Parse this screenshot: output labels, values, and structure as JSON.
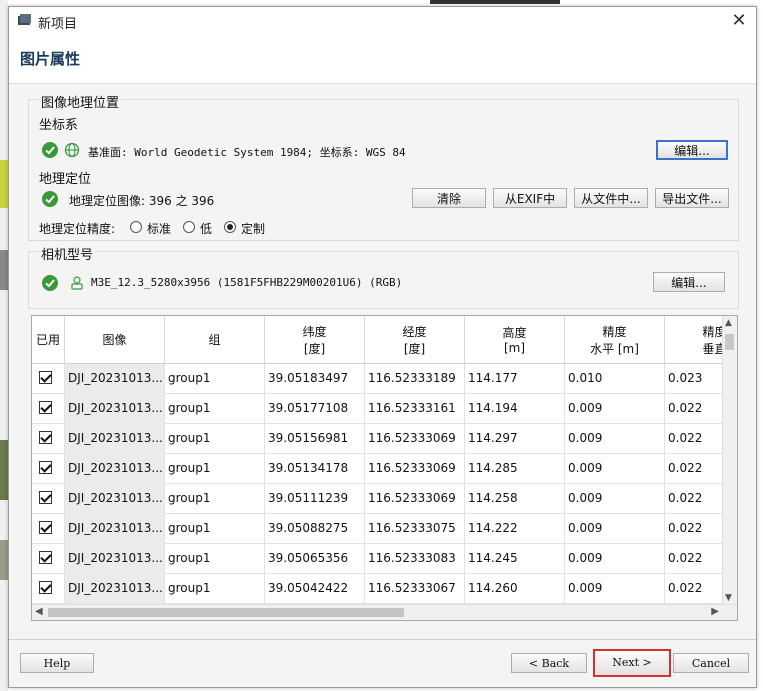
{
  "window": {
    "title": "新项目",
    "close_symbol": "✕"
  },
  "header": {
    "title": "图片属性"
  },
  "geo": {
    "group_title": "图像地理位置",
    "crs_heading": "坐标系",
    "crs_text": "基准面: World Geodetic System 1984; 坐标系: WGS 84",
    "edit_label": "编辑...",
    "geolocation_heading": "地理定位",
    "geolocated_text": "地理定位图像: 396 之 396",
    "clear_label": "清除",
    "from_exif_label": "从EXIF中",
    "from_file_label": "从文件中...",
    "export_label": "导出文件...",
    "accuracy_label": "地理定位精度:",
    "accuracy_options": [
      "标准",
      "低",
      "定制"
    ],
    "accuracy_selected": "定制"
  },
  "camera": {
    "group_title": "相机型号",
    "model_text": "M3E_12.3_5280x3956 (1581F5FHB229M00201U6) (RGB)",
    "edit_label": "编辑..."
  },
  "table": {
    "headers": [
      {
        "l1": "已用",
        "l2": ""
      },
      {
        "l1": "图像",
        "l2": ""
      },
      {
        "l1": "组",
        "l2": ""
      },
      {
        "l1": "纬度",
        "l2": "[度]"
      },
      {
        "l1": "经度",
        "l2": "[度]"
      },
      {
        "l1": "高度",
        "l2": "[m]"
      },
      {
        "l1": "精度",
        "l2": "水平 [m]"
      },
      {
        "l1": "精度",
        "l2": "垂直"
      }
    ],
    "rows": [
      {
        "image": "DJI_20231013...",
        "group": "group1",
        "lat": "39.05183497",
        "lon": "116.52333189",
        "alt": "114.177",
        "acc_h": "0.010",
        "acc_v": "0.023"
      },
      {
        "image": "DJI_20231013...",
        "group": "group1",
        "lat": "39.05177108",
        "lon": "116.52333161",
        "alt": "114.194",
        "acc_h": "0.009",
        "acc_v": "0.022"
      },
      {
        "image": "DJI_20231013...",
        "group": "group1",
        "lat": "39.05156981",
        "lon": "116.52333069",
        "alt": "114.297",
        "acc_h": "0.009",
        "acc_v": "0.022"
      },
      {
        "image": "DJI_20231013...",
        "group": "group1",
        "lat": "39.05134178",
        "lon": "116.52333069",
        "alt": "114.285",
        "acc_h": "0.009",
        "acc_v": "0.022"
      },
      {
        "image": "DJI_20231013...",
        "group": "group1",
        "lat": "39.05111239",
        "lon": "116.52333069",
        "alt": "114.258",
        "acc_h": "0.009",
        "acc_v": "0.022"
      },
      {
        "image": "DJI_20231013...",
        "group": "group1",
        "lat": "39.05088275",
        "lon": "116.52333075",
        "alt": "114.222",
        "acc_h": "0.009",
        "acc_v": "0.022"
      },
      {
        "image": "DJI_20231013...",
        "group": "group1",
        "lat": "39.05065356",
        "lon": "116.52333083",
        "alt": "114.245",
        "acc_h": "0.009",
        "acc_v": "0.022"
      },
      {
        "image": "DJI_20231013...",
        "group": "group1",
        "lat": "39.05042422",
        "lon": "116.52333067",
        "alt": "114.260",
        "acc_h": "0.009",
        "acc_v": "0.022"
      }
    ]
  },
  "footer": {
    "help_label": "Help",
    "back_label": "< Back",
    "next_label": "Next >",
    "cancel_label": "Cancel"
  },
  "colors": {
    "check_green": "#3a9a3a",
    "title_blue": "#1b3a5c",
    "focus_red": "#d93030"
  }
}
